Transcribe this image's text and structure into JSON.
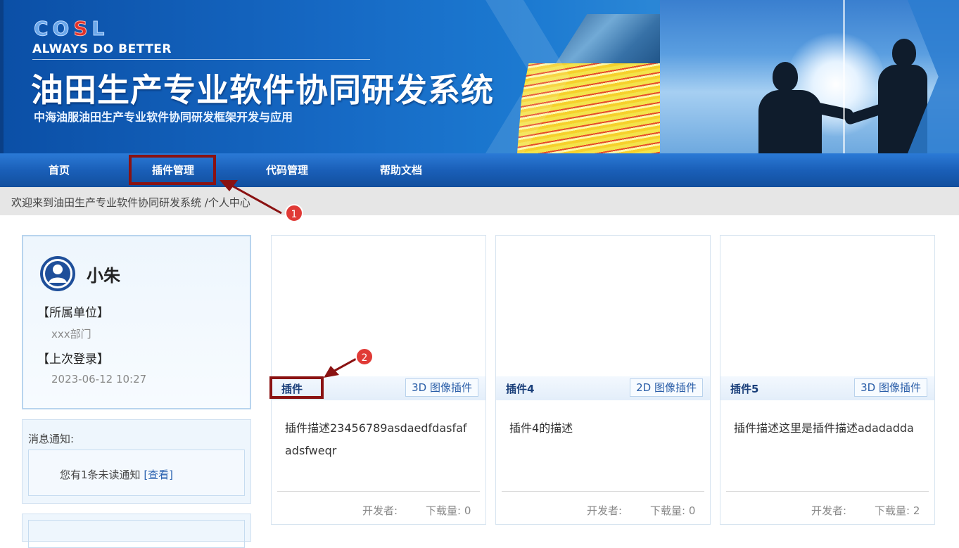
{
  "banner": {
    "logo": "COSL",
    "slogan": "ALWAYS DO BETTER",
    "title": "油田生产专业软件协同研发系统",
    "subtitle": "中海油服油田生产专业软件协同研发框架开发与应用"
  },
  "nav": {
    "items": [
      {
        "label": "首页"
      },
      {
        "label": "插件管理"
      },
      {
        "label": "代码管理"
      },
      {
        "label": "帮助文档"
      }
    ]
  },
  "breadcrumb": "欢迎来到油田生产专业软件协同研发系统 /个人中心",
  "profile": {
    "name": "小朱",
    "unit_label": "【所属单位】",
    "unit_value": "xxx部门",
    "last_login_label": "【上次登录】",
    "last_login_value": "2023-06-12 10:27"
  },
  "notice": {
    "title": "消息通知:",
    "text": "您有1条未读通知 ",
    "link": "[查看]"
  },
  "cards": [
    {
      "name": "插件",
      "tag": "3D 图像插件",
      "desc": "插件描述23456789asdaedfdasfafadsfweqr",
      "developer_label": "开发者:",
      "downloads_label": "下载量: 0"
    },
    {
      "name": "插件4",
      "tag": "2D 图像插件",
      "desc": "插件4的描述",
      "developer_label": "开发者:",
      "downloads_label": "下载量: 0"
    },
    {
      "name": "插件5",
      "tag": "3D 图像插件",
      "desc": "插件描述这里是插件描述adadadda",
      "developer_label": "开发者:",
      "downloads_label": "下载量: 2"
    }
  ],
  "annotations": {
    "badge1": "1",
    "badge2": "2",
    "color": "#8a1212"
  },
  "colors": {
    "nav": "#1a5fb8",
    "badge": "#e03a36",
    "link": "#2a62b0"
  }
}
